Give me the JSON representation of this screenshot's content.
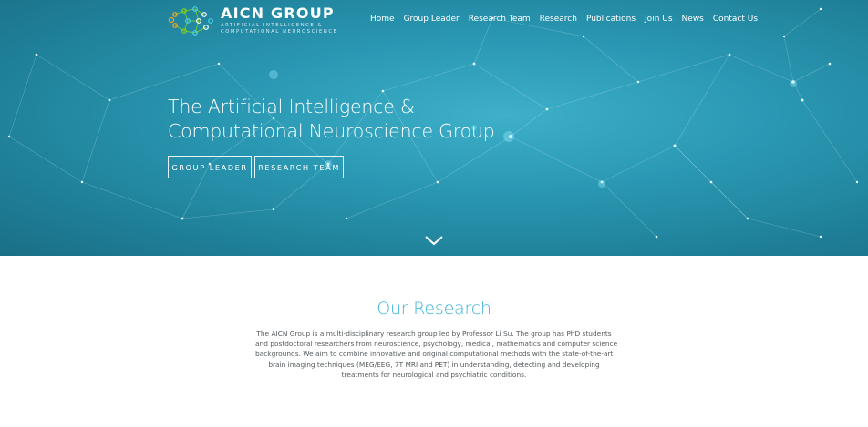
{
  "brand": {
    "title": "AICN GROUP",
    "subtitle_line1": "ARTIFICIAL INTELLIGENCE &",
    "subtitle_line2": "COMPUTATIONAL NEUROSCIENCE",
    "logo_colors": [
      "#f5a623",
      "#7ed321",
      "#4ad0e8",
      "#ffffff"
    ]
  },
  "nav": {
    "items": [
      "Home",
      "Group Leader",
      "Research Team",
      "Research",
      "Publications",
      "Join Us",
      "News",
      "Contact Us"
    ]
  },
  "hero": {
    "title_line1": "The Artificial Intelligence &",
    "title_line2": "Computational Neuroscience Group",
    "button_group_leader": "GROUP LEADER",
    "button_research_team": "RESEARCH TEAM",
    "scroll_icon": "chevron-down-icon",
    "background_color": "#2a98b3"
  },
  "research": {
    "title": "Our Research",
    "title_color": "#3fb4d6",
    "description_lines": [
      "The AICN Group is a multi-disciplinary research group led by Professor Li Su. The group has PhD students",
      "and postdoctoral researchers from neuroscience, psychology, medical, mathematics and computer science",
      "backgrounds. We aim to combine innovative and original computational methods with the state-of-the-art",
      "brain imaging techniques (MEG/EEG, 7T MRI and PET) in understanding, detecting and developing",
      "treatments for neurological and psychiatric conditions."
    ]
  }
}
